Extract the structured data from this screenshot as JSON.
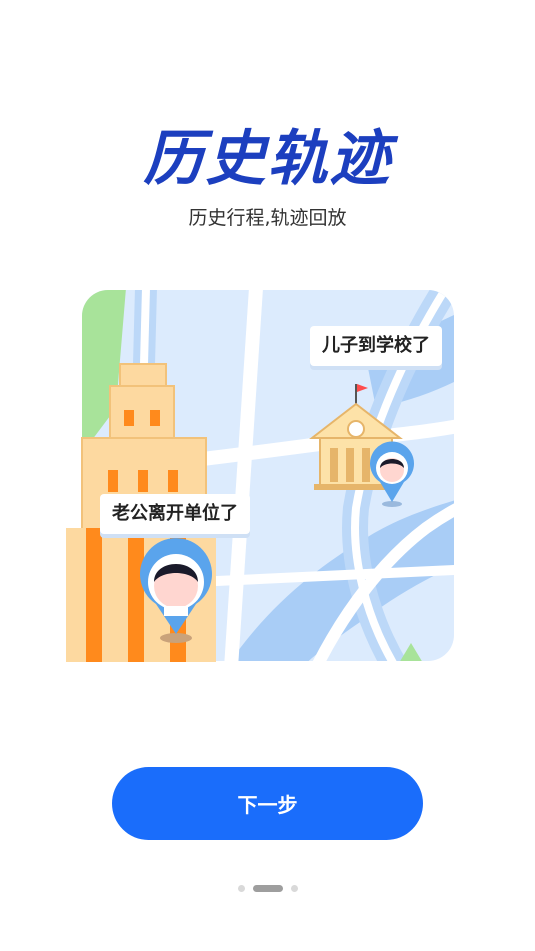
{
  "header": {
    "title": "历史轨迹",
    "subtitle": "历史行程,轨迹回放"
  },
  "illustration": {
    "callouts": {
      "school": "儿子到学校了",
      "work": "老公离开单位了"
    },
    "colors": {
      "map_bg": "#dcebfd",
      "road": "#ffffff",
      "river": "#a9cdf6",
      "park": "#a8e39a",
      "building": "#fdd9a0",
      "building_stripe": "#ff8a1c",
      "pin": "#5aa4ec"
    }
  },
  "actions": {
    "next_label": "下一步"
  },
  "pager": {
    "total": 3,
    "active": 2
  },
  "colors": {
    "accent": "#1a6dfb",
    "title": "#1c3fbf"
  }
}
